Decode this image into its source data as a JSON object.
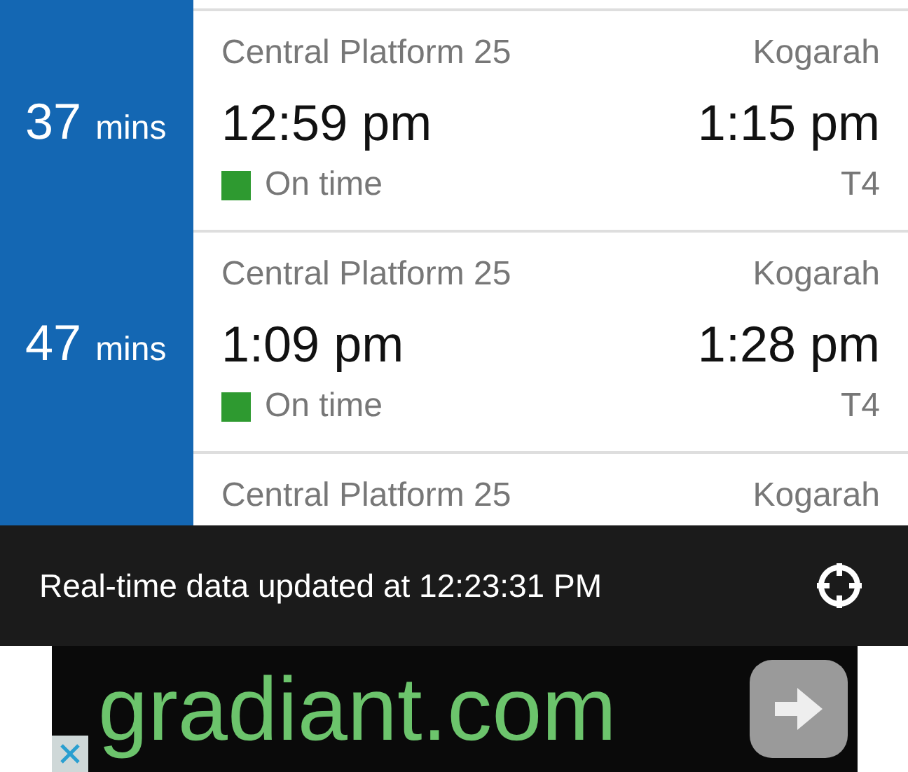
{
  "trips": [
    {
      "minutes": "37",
      "minutes_unit": "mins",
      "origin": "Central Platform 25",
      "destination": "Kogarah",
      "departure": "12:59 pm",
      "arrival": "1:15 pm",
      "status": "On time",
      "color": "#2e9a30",
      "line": "T4"
    },
    {
      "minutes": "47",
      "minutes_unit": "mins",
      "origin": "Central Platform 25",
      "destination": "Kogarah",
      "departure": "1:09 pm",
      "arrival": "1:28 pm",
      "status": "On time",
      "color": "#2e9a30",
      "line": "T4"
    },
    {
      "origin": "Central Platform 25",
      "destination": "Kogarah"
    }
  ],
  "status_bar": {
    "text": "Real-time data updated at 12:23:31 PM"
  },
  "ad": {
    "text": "gradiant.com"
  }
}
